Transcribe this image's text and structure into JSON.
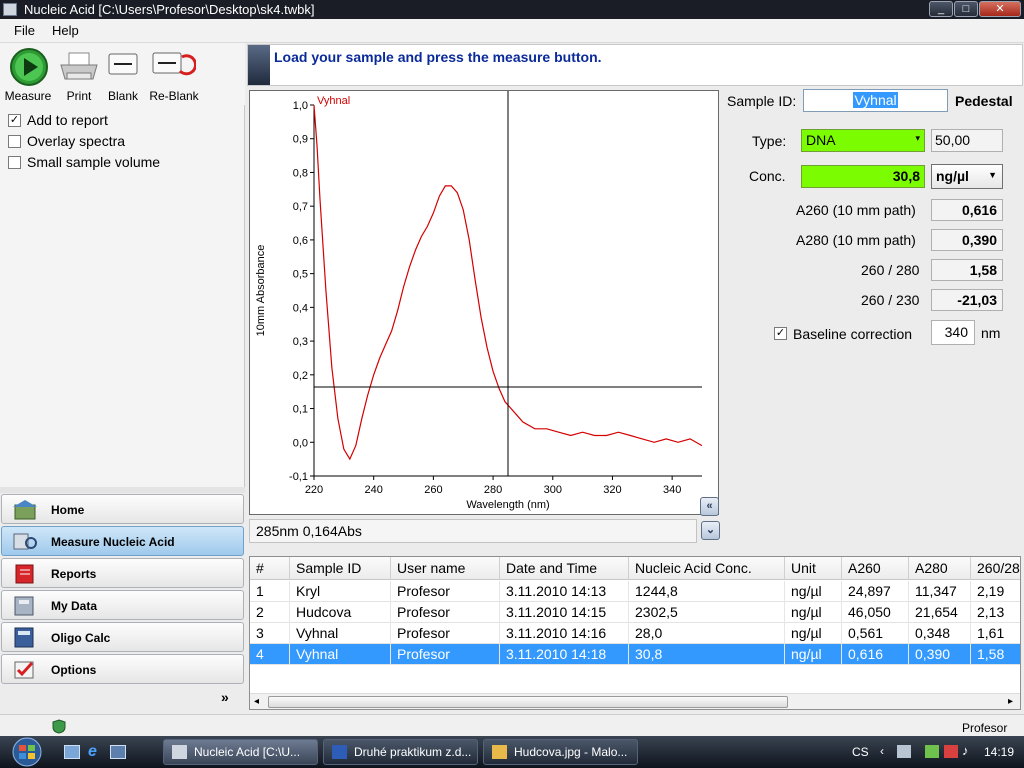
{
  "window": {
    "title": "Nucleic Acid  [C:\\Users\\Profesor\\Desktop\\sk4.twbk]"
  },
  "menu": {
    "file": "File",
    "help": "Help"
  },
  "toolbar": {
    "measure": "Measure",
    "print": "Print",
    "blank": "Blank",
    "reblank": "Re-Blank"
  },
  "options": {
    "add_report": "Add to report",
    "overlay": "Overlay spectra",
    "small_volume": "Small sample volume"
  },
  "nav": {
    "home": "Home",
    "measure": "Measure Nucleic Acid",
    "reports": "Reports",
    "mydata": "My Data",
    "oligo": "Oligo Calc",
    "options": "Options"
  },
  "banner": {
    "message": "Load your sample and press the measure button."
  },
  "readout": "285nm 0,164Abs",
  "sample": {
    "id_label": "Sample ID:",
    "id_value": "Vyhnal",
    "pedestal": "Pedestal",
    "type_label": "Type:",
    "type_value": "DNA",
    "factor": "50,00",
    "conc_label": "Conc.",
    "conc_value": "30,8",
    "conc_unit": "ng/µl",
    "a260_label": "A260 (10 mm path)",
    "a260_value": "0,616",
    "a280_label": "A280 (10 mm path)",
    "a280_value": "0,390",
    "r260_280_label": "260 / 280",
    "r260_280_value": "1,58",
    "r260_230_label": "260 / 230",
    "r260_230_value": "-21,03",
    "baseline_label": "Baseline correction",
    "baseline_value": "340",
    "baseline_unit": "nm"
  },
  "table": {
    "headers": [
      "#",
      "Sample ID",
      "User name",
      "Date and Time",
      "Nucleic Acid Conc.",
      "Unit",
      "A260",
      "A280",
      "260/28"
    ],
    "rows": [
      [
        "1",
        "Kryl",
        "Profesor",
        "3.11.2010 14:13",
        "1244,8",
        "ng/µl",
        "24,897",
        "11,347",
        "2,19"
      ],
      [
        "2",
        "Hudcova",
        "Profesor",
        "3.11.2010 14:15",
        "2302,5",
        "ng/µl",
        "46,050",
        "21,654",
        "2,13"
      ],
      [
        "3",
        "Vyhnal",
        "Profesor",
        "3.11.2010 14:16",
        "28,0",
        "ng/µl",
        "0,561",
        "0,348",
        "1,61"
      ],
      [
        "4",
        "Vyhnal",
        "Profesor",
        "3.11.2010 14:18",
        "30,8",
        "ng/µl",
        "0,616",
        "0,390",
        "1,58"
      ]
    ]
  },
  "status": {
    "user": "Profesor"
  },
  "taskbar": {
    "tasks": [
      "Nucleic Acid  [C:\\U...",
      "Druhé praktikum z.d...",
      "Hudcova.jpg - Malo..."
    ],
    "lang": "CS",
    "clock": "14:19"
  },
  "colors": {
    "accent_green": "#7cfc00",
    "selection_blue": "#3399ff",
    "curve_red": "#d40000",
    "banner_text": "#0a2a9a"
  },
  "chart_data": {
    "type": "line",
    "xlabel": "Wavelength (nm)",
    "ylabel": "10mm Absorbance",
    "xlim": [
      220,
      350
    ],
    "ylim": [
      -0.1,
      1.0
    ],
    "xticks": [
      "220",
      "240",
      "260",
      "280",
      "300",
      "320",
      "340"
    ],
    "yticks": [
      "1,0",
      "0,9",
      "0,8",
      "0,7",
      "0,6",
      "0,5",
      "0,4",
      "0,3",
      "0,2",
      "0,1",
      "0,0",
      "-0,1"
    ],
    "series": [
      {
        "name": "Vyhnal",
        "x": [
          220,
          221,
          222,
          224,
          226,
          228,
          230,
          232,
          234,
          236,
          238,
          240,
          242,
          244,
          246,
          248,
          250,
          252,
          254,
          256,
          258,
          260,
          262,
          264,
          266,
          268,
          270,
          272,
          274,
          276,
          278,
          280,
          282,
          284,
          286,
          288,
          290,
          294,
          298,
          302,
          306,
          310,
          314,
          318,
          322,
          326,
          330,
          334,
          338,
          342,
          346,
          350
        ],
        "y": [
          1.0,
          0.88,
          0.72,
          0.45,
          0.22,
          0.07,
          -0.02,
          -0.05,
          -0.01,
          0.07,
          0.14,
          0.2,
          0.25,
          0.29,
          0.33,
          0.39,
          0.46,
          0.52,
          0.57,
          0.61,
          0.64,
          0.68,
          0.73,
          0.76,
          0.76,
          0.74,
          0.69,
          0.6,
          0.48,
          0.37,
          0.28,
          0.21,
          0.16,
          0.12,
          0.1,
          0.08,
          0.06,
          0.04,
          0.04,
          0.03,
          0.02,
          0.03,
          0.02,
          0.02,
          0.03,
          0.02,
          0.01,
          0.0,
          0.01,
          0.0,
          0.01,
          -0.01
        ]
      }
    ],
    "cursor": {
      "x": 285,
      "y": 0.164
    }
  }
}
